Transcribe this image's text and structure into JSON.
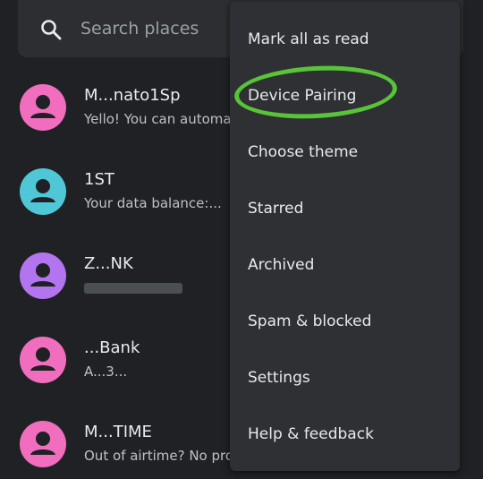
{
  "search": {
    "placeholder": "Search places"
  },
  "conversations": [
    {
      "name": "M...nato1Sp",
      "snippet": "Yello! You can automate",
      "avatar_color": "#f06ebd"
    },
    {
      "name": "1ST",
      "snippet": "Your data balance:...",
      "avatar_color": "#4fc7d6"
    },
    {
      "name": "Z...NK",
      "snippet": "",
      "avatar_color": "#b374f0"
    },
    {
      "name": "...Bank",
      "snippet": "A...3...",
      "avatar_color": "#f06ebd"
    },
    {
      "name": "M...TIME",
      "snippet": "Out of airtime? No probl",
      "avatar_color": "#f06ebd"
    }
  ],
  "menu": {
    "items": [
      {
        "label": "Mark all as read"
      },
      {
        "label": "Device Pairing"
      },
      {
        "label": "Choose theme"
      },
      {
        "label": "Starred"
      },
      {
        "label": "Archived"
      },
      {
        "label": "Spam & blocked"
      },
      {
        "label": "Settings"
      },
      {
        "label": "Help & feedback"
      }
    ]
  },
  "colors": {
    "background": "#202124",
    "menu_background": "#2f3034",
    "highlight": "#58c437"
  }
}
